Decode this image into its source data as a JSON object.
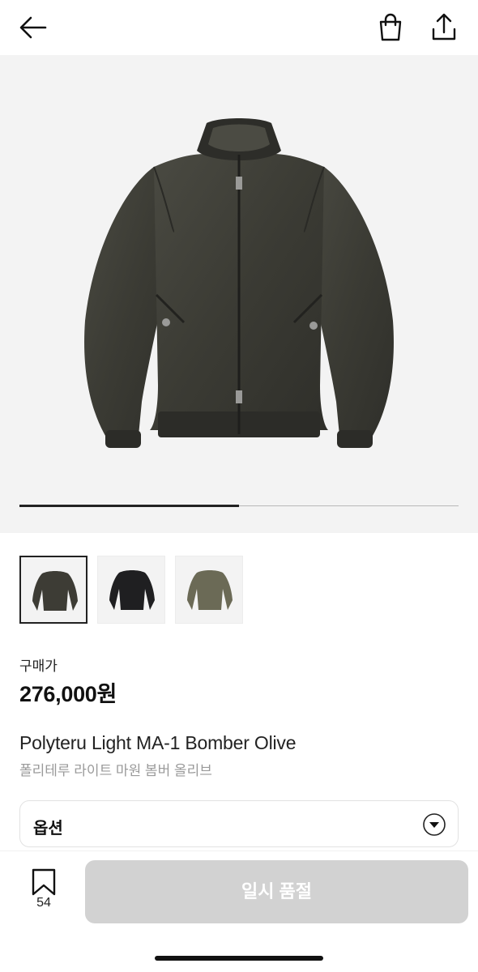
{
  "header": {
    "back_icon": "arrow-left-icon",
    "bag_icon": "shopping-bag-icon",
    "share_icon": "share-upload-icon"
  },
  "gallery": {
    "progress": 0.5,
    "main_image": "olive bomber jacket photo",
    "thumbnails": [
      {
        "name": "olive",
        "color": "#3d3c35",
        "selected": true
      },
      {
        "name": "black",
        "color": "#1f1f21",
        "selected": false
      },
      {
        "name": "khaki",
        "color": "#6b6a56",
        "selected": false
      }
    ]
  },
  "price": {
    "label": "구매가",
    "value": "276,000원"
  },
  "product": {
    "name_en": "Polyteru Light MA-1 Bomber Olive",
    "name_ko": "폴리테루 라이트 마원 봄버 올리브"
  },
  "option": {
    "label": "옵션",
    "icon": "caret-down-circle-icon"
  },
  "footer": {
    "bookmark_icon": "bookmark-icon",
    "bookmark_count": "54",
    "buy_label": "일시 품절"
  },
  "colors": {
    "disabled_button": "#d2d2d2",
    "hero_background": "#f3f3f3"
  }
}
